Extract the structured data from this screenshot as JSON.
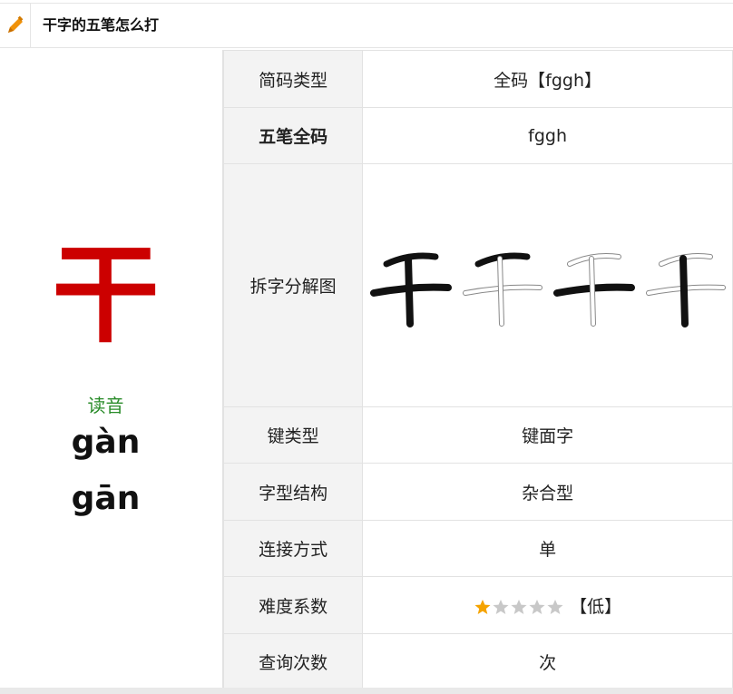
{
  "header": {
    "title": "干字的五笔怎么打",
    "icon": "pencil-icon",
    "icon_color": "#f0920a"
  },
  "left": {
    "character": "干",
    "character_color": "#cc0000",
    "reading_label": "读音",
    "readings": [
      "gàn",
      "gān"
    ]
  },
  "rows": [
    {
      "label": "简码类型",
      "value": "全码【fggh】"
    },
    {
      "label": "五笔全码",
      "value": "fggh"
    },
    {
      "label": "拆字分解图",
      "value": ""
    },
    {
      "label": "键类型",
      "value": "键面字"
    },
    {
      "label": "字型结构",
      "value": "杂合型"
    },
    {
      "label": "连接方式",
      "value": "单"
    },
    {
      "label": "难度系数",
      "value": "【低】"
    },
    {
      "label": "查询次数",
      "value": "次"
    }
  ],
  "difficulty": {
    "rating": 1,
    "max": 5,
    "active_color": "#f5a300",
    "inactive_color": "#c8c8c8"
  },
  "decomposition": {
    "glyphs": [
      "干",
      "干",
      "干",
      "干"
    ]
  }
}
